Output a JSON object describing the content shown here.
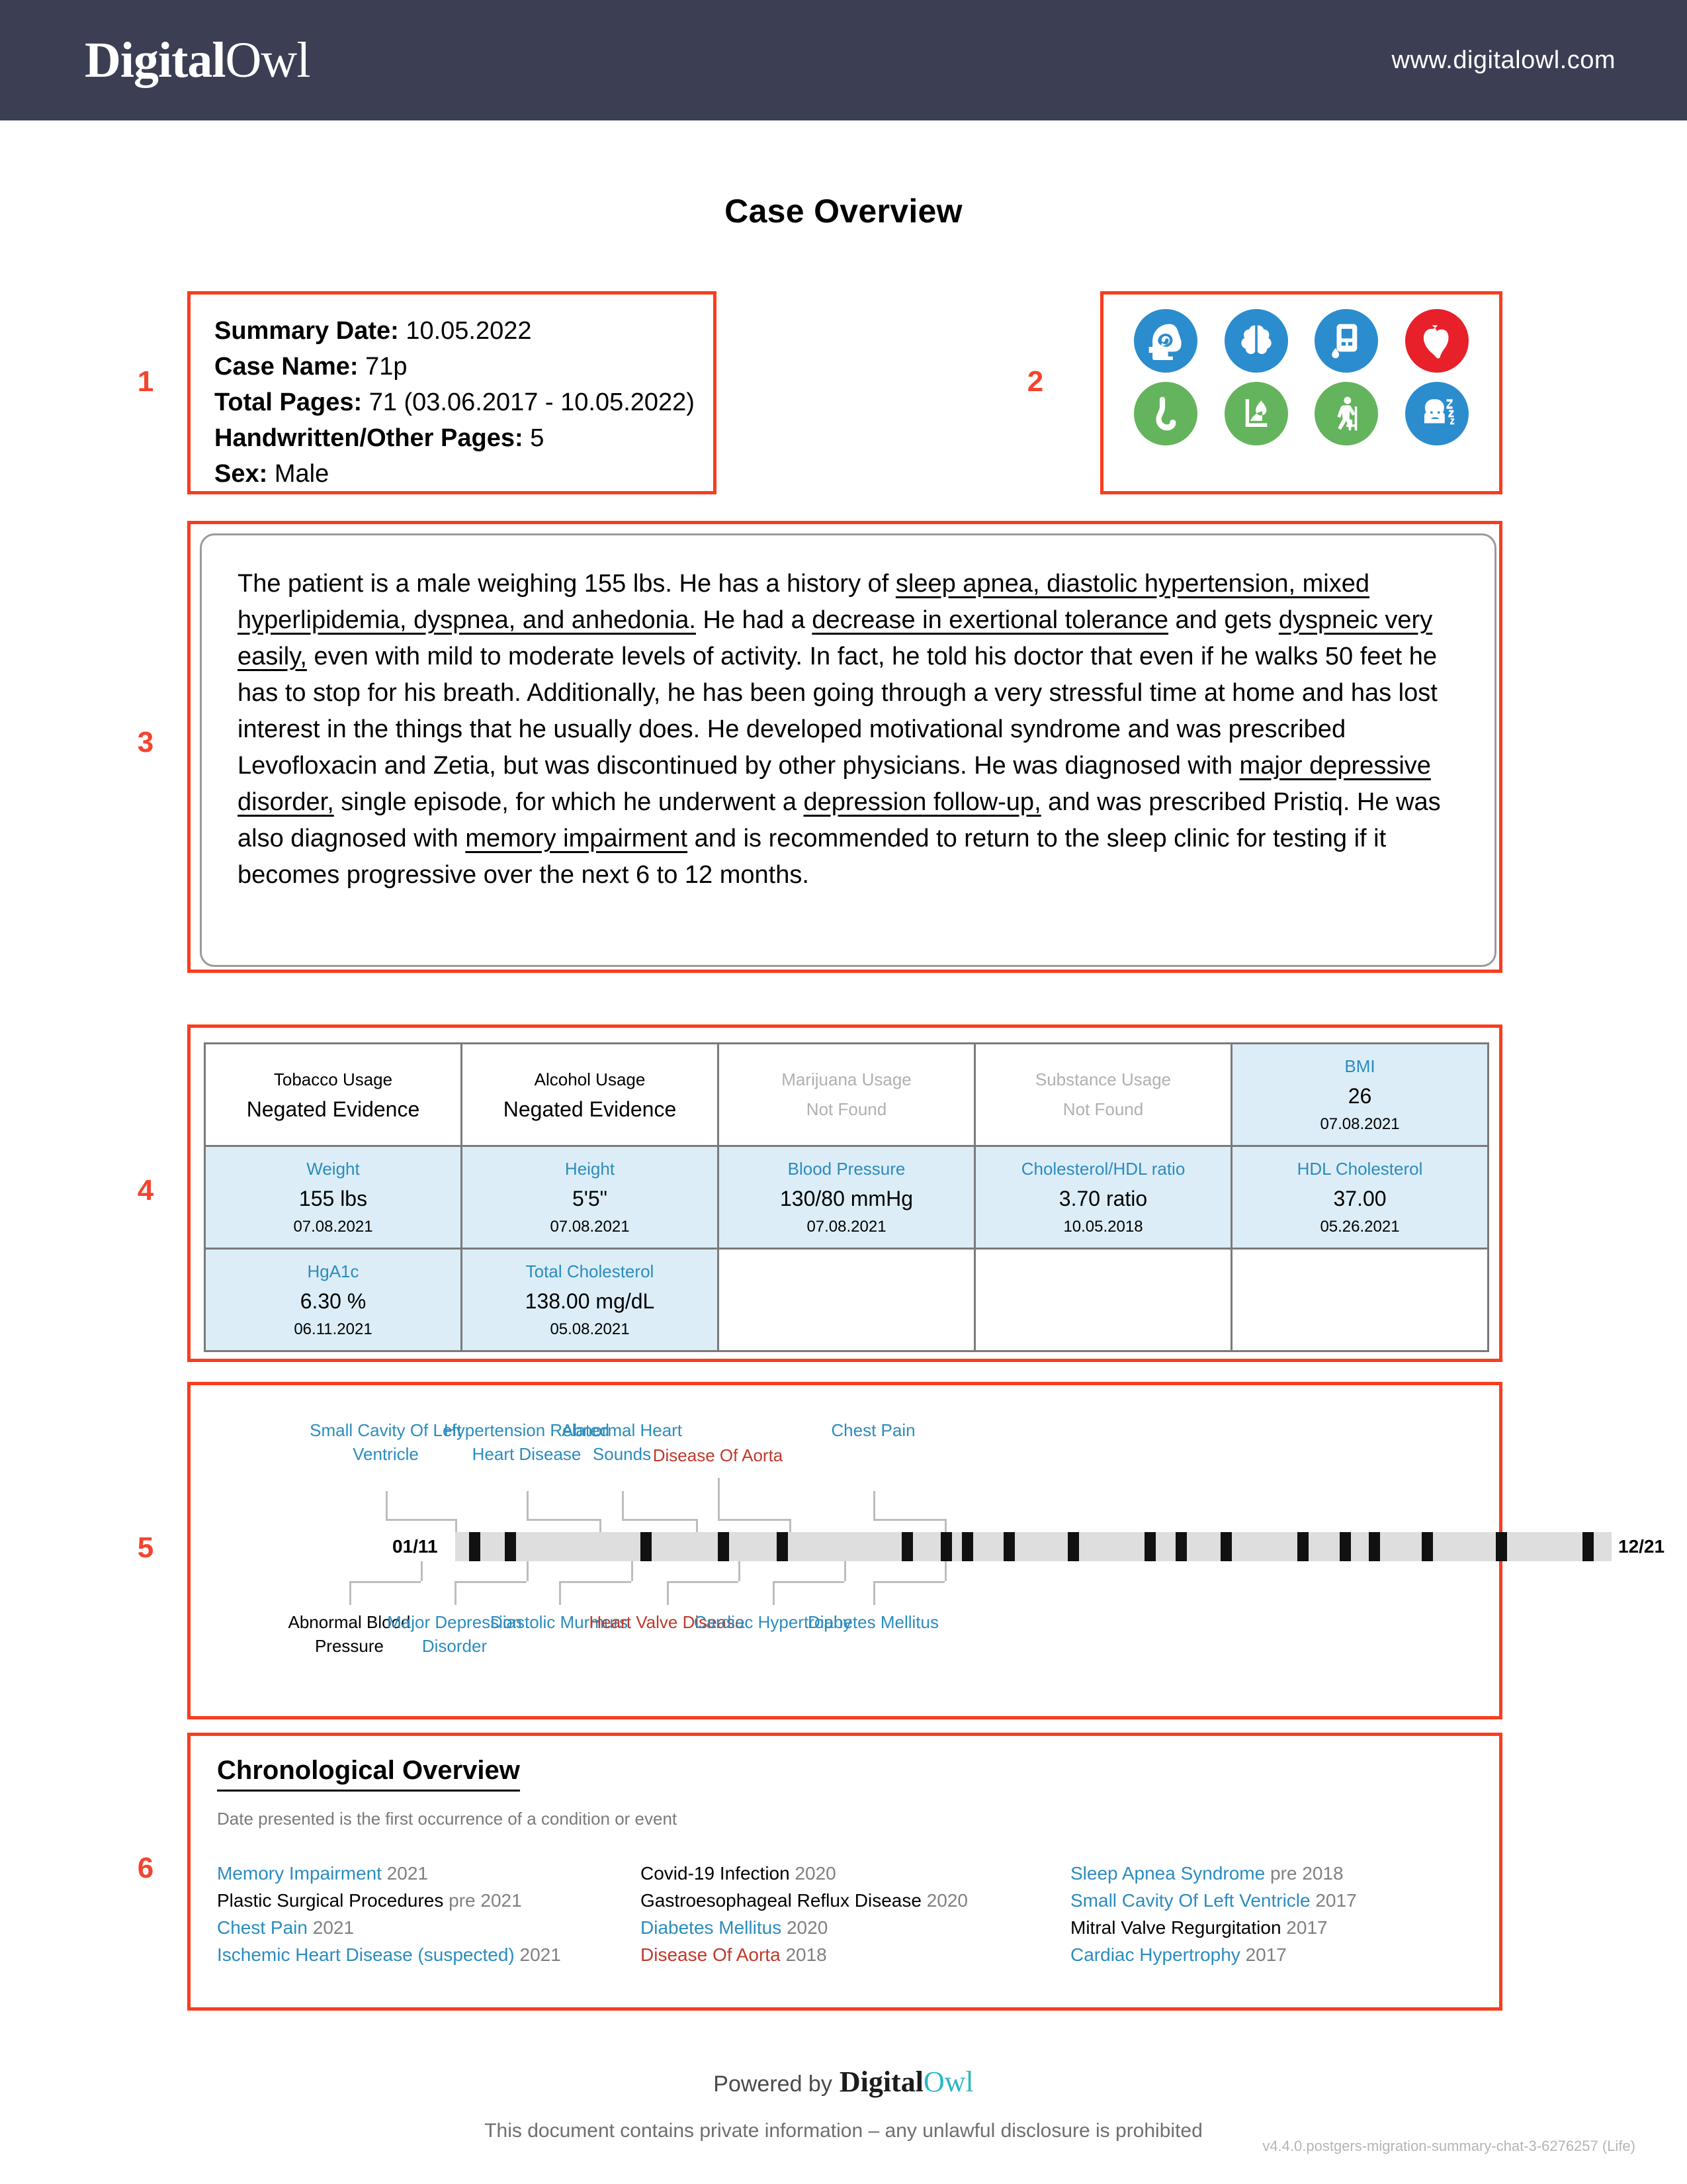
{
  "header": {
    "logo_bold": "Digital",
    "logo_light": "Owl",
    "url": "www.digitalowl.com"
  },
  "page_title": "Case Overview",
  "section_numbers": {
    "n1": "1",
    "n2": "2",
    "n3": "3",
    "n4": "4",
    "n5": "5",
    "n6": "6"
  },
  "summary": {
    "rows": [
      {
        "key": "Summary Date:",
        "value": "10.05.2022"
      },
      {
        "key": "Case Name:",
        "value": "71p"
      },
      {
        "key": "Total Pages:",
        "value": "71 (03.06.2017 - 10.05.2022)"
      },
      {
        "key": "Handwritten/Other Pages:",
        "value": "5"
      },
      {
        "key": "Sex:",
        "value": "Male"
      }
    ]
  },
  "icons": [
    {
      "name": "mental-health-head-icon",
      "color": "#2b8cce"
    },
    {
      "name": "brain-icon",
      "color": "#2b8cce"
    },
    {
      "name": "glucometer-icon",
      "color": "#2b8cce"
    },
    {
      "name": "heart-icon",
      "color": "#e8202a"
    },
    {
      "name": "stomach-icon",
      "color": "#63b45c"
    },
    {
      "name": "liver-fluid-icon",
      "color": "#63b45c"
    },
    {
      "name": "elderly-walker-icon",
      "color": "#63b45c"
    },
    {
      "name": "sleep-apnea-icon",
      "color": "#2b8cce"
    }
  ],
  "narrative": {
    "segments": [
      {
        "t": "The patient is a male weighing 155 lbs. He has a history of ",
        "u": false
      },
      {
        "t": "sleep apnea, diastolic hypertension, mixed hyperlipidemia, dyspnea, and anhedonia.",
        "u": true
      },
      {
        "t": " He had a ",
        "u": false
      },
      {
        "t": "decrease in exertional tolerance",
        "u": true
      },
      {
        "t": " and gets ",
        "u": false
      },
      {
        "t": "dyspneic very easily,",
        "u": true
      },
      {
        "t": " even with mild to moderate levels of activity. In fact, he told his doctor that even if he walks 50 feet he has to stop for his breath. Additionally, he has been going through a very stressful time at home and has lost interest in the things that he usually does. He developed motivational syndrome and was prescribed Levofloxacin and Zetia, but was discontinued by other physicians. He was diagnosed with ",
        "u": false
      },
      {
        "t": "major depressive disorder,",
        "u": true
      },
      {
        "t": " single episode, for which he underwent a ",
        "u": false
      },
      {
        "t": "depression follow-up,",
        "u": true
      },
      {
        "t": " and was prescribed Pristiq. He was also diagnosed with ",
        "u": false
      },
      {
        "t": "memory impairment",
        "u": true
      },
      {
        "t": " and is recommended to return to the sleep clinic for testing if it becomes progressive over the next 6 to 12 months.",
        "u": false
      }
    ]
  },
  "vitals": {
    "rows": [
      [
        {
          "label": "Tobacco Usage",
          "value": "Negated Evidence",
          "date": "",
          "style": "plain",
          "shaded": false
        },
        {
          "label": "Alcohol Usage",
          "value": "Negated Evidence",
          "date": "",
          "style": "plain",
          "shaded": false
        },
        {
          "label": "Marijuana Usage",
          "value": "Not Found",
          "date": "",
          "style": "muted",
          "shaded": false
        },
        {
          "label": "Substance Usage",
          "value": "Not Found",
          "date": "",
          "style": "muted",
          "shaded": false
        },
        {
          "label": "BMI",
          "value": "26",
          "date": "07.08.2021",
          "style": "blue",
          "shaded": true
        }
      ],
      [
        {
          "label": "Weight",
          "value": "155 lbs",
          "date": "07.08.2021",
          "style": "blue",
          "shaded": true
        },
        {
          "label": "Height",
          "value": "5'5\"",
          "date": "07.08.2021",
          "style": "blue",
          "shaded": true
        },
        {
          "label": "Blood Pressure",
          "value": "130/80 mmHg",
          "date": "07.08.2021",
          "style": "blue",
          "shaded": true
        },
        {
          "label": "Cholesterol/HDL ratio",
          "value": "3.70 ratio",
          "date": "10.05.2018",
          "style": "blue",
          "shaded": true
        },
        {
          "label": "HDL Cholesterol",
          "value": "37.00",
          "date": "05.26.2021",
          "style": "blue",
          "shaded": true
        }
      ],
      [
        {
          "label": "HgA1c",
          "value": "6.30 %",
          "date": "06.11.2021",
          "style": "blue",
          "shaded": true
        },
        {
          "label": "Total Cholesterol",
          "value": "138.00 mg/dL",
          "date": "05.08.2021",
          "style": "blue",
          "shaded": true
        },
        {
          "label": "",
          "value": "",
          "date": "",
          "style": "blank",
          "shaded": false
        },
        {
          "label": "",
          "value": "",
          "date": "",
          "style": "blank",
          "shaded": false
        },
        {
          "label": "",
          "value": "",
          "date": "",
          "style": "blank",
          "shaded": false
        }
      ]
    ]
  },
  "timeline": {
    "start_label": "01/11",
    "end_label": "12/21",
    "ticks_pct": [
      1.2,
      4.3,
      16.0,
      22.7,
      27.8,
      38.6,
      42.0,
      43.8,
      47.4,
      53.0,
      59.6,
      62.3,
      66.2,
      72.8,
      76.5,
      79.0,
      83.6,
      90.0,
      97.5
    ],
    "above": [
      {
        "label": "Small Cavity Of Left Ventricle",
        "color": "blue",
        "label_x": 295,
        "tick_x": 400,
        "depth": 1
      },
      {
        "label": "Hypertension Related Heart Disease",
        "color": "blue",
        "label_x": 508,
        "tick_x": 618,
        "depth": 1
      },
      {
        "label": "Abnormal Heart Sounds",
        "color": "blue",
        "label_x": 652,
        "tick_x": 764,
        "depth": 1
      },
      {
        "label": "Disease Of Aorta",
        "color": "red",
        "label_x": 797,
        "tick_x": 905,
        "depth": 2
      },
      {
        "label": "Chest Pain",
        "color": "blue",
        "label_x": 1032,
        "tick_x": 1140,
        "depth": 1
      }
    ],
    "below": [
      {
        "label": "Abnormal Blood Pressure",
        "color": "black",
        "label_x": 240,
        "tick_x": 348,
        "depth": 1
      },
      {
        "label": "Major Depression Disorder",
        "color": "blue",
        "label_x": 399,
        "tick_x": 508,
        "depth": 1
      },
      {
        "label": "Diastolic Murmurs",
        "color": "blue",
        "label_x": 557,
        "tick_x": 666,
        "depth": 1
      },
      {
        "label": "Heart Valve Disease",
        "color": "red",
        "label_x": 720,
        "tick_x": 828,
        "depth": 1
      },
      {
        "label": "Cardiac Hypertrophy",
        "color": "blue",
        "label_x": 880,
        "tick_x": 988,
        "depth": 2
      },
      {
        "label": "Diabetes Mellitus",
        "color": "blue",
        "label_x": 1032,
        "tick_x": 1140,
        "depth": 2
      }
    ]
  },
  "chronological": {
    "title": "Chronological Overview",
    "subtitle": "Date presented is the first occurrence of a condition or event",
    "columns": [
      [
        {
          "name": "Memory Impairment",
          "color": "blue",
          "year": "2021"
        },
        {
          "name": "Plastic Surgical Procedures",
          "color": "black",
          "year": "pre 2021"
        },
        {
          "name": "Chest Pain",
          "color": "blue",
          "year": "2021"
        },
        {
          "name": "Ischemic Heart Disease (suspected)",
          "color": "blue",
          "year": "2021"
        }
      ],
      [
        {
          "name": "Covid-19 Infection",
          "color": "black",
          "year": "2020"
        },
        {
          "name": "Gastroesophageal Reflux Disease",
          "color": "black",
          "year": "2020"
        },
        {
          "name": "Diabetes Mellitus",
          "color": "blue",
          "year": "2020"
        },
        {
          "name": "Disease Of Aorta",
          "color": "red",
          "year": "2018"
        }
      ],
      [
        {
          "name": "Sleep Apnea Syndrome",
          "color": "blue",
          "year": "pre 2018"
        },
        {
          "name": "Small Cavity Of Left Ventricle",
          "color": "blue",
          "year": "2017"
        },
        {
          "name": "Mitral Valve Regurgitation",
          "color": "black",
          "year": "2017"
        },
        {
          "name": "Cardiac Hypertrophy",
          "color": "blue",
          "year": "2017"
        }
      ]
    ]
  },
  "footer": {
    "powered_by": "Powered by",
    "logo_bold": "Digital",
    "logo_light": "Owl",
    "notice": "This document contains private information – any unlawful disclosure is prohibited",
    "version": "v4.4.0.postgers-migration-summary-chat-3-6276257 (Life)"
  }
}
